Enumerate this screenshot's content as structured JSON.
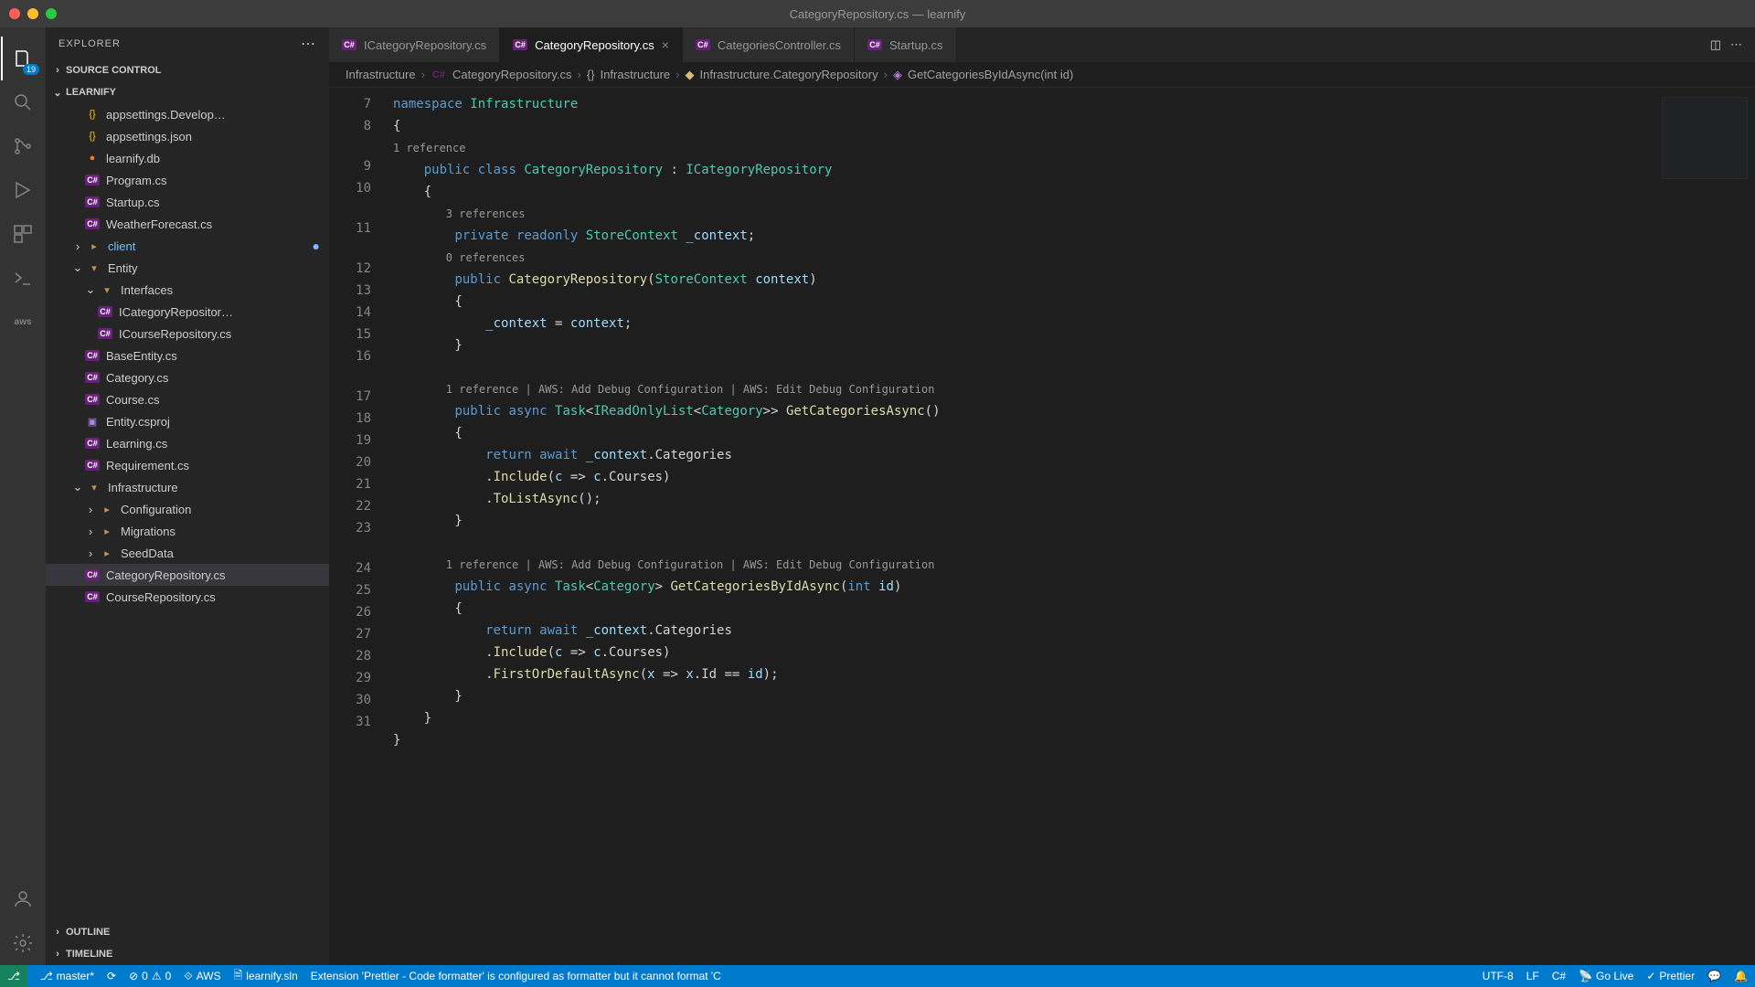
{
  "window": {
    "title": "CategoryRepository.cs — learnify"
  },
  "activitybar": {
    "badge": "19",
    "aws": "aws"
  },
  "explorer": {
    "title": "EXPLORER",
    "sections": {
      "source_control": "SOURCE CONTROL",
      "project": "LEARNIFY",
      "outline": "OUTLINE",
      "timeline": "TIMELINE"
    },
    "tree": {
      "appsettings_dev": "appsettings.Develop…",
      "appsettings": "appsettings.json",
      "learnifydb": "learnify.db",
      "program": "Program.cs",
      "startup": "Startup.cs",
      "weather": "WeatherForecast.cs",
      "client": "client",
      "entity": "Entity",
      "interfaces": "Interfaces",
      "icategory": "ICategoryRepositor…",
      "icourse": "ICourseRepository.cs",
      "baseentity": "BaseEntity.cs",
      "category": "Category.cs",
      "course": "Course.cs",
      "entitycsproj": "Entity.csproj",
      "learning": "Learning.cs",
      "requirement": "Requirement.cs",
      "infrastructure": "Infrastructure",
      "configuration": "Configuration",
      "migrations": "Migrations",
      "seeddata": "SeedData",
      "catrepo": "CategoryRepository.cs",
      "courserepo": "CourseRepository.cs"
    }
  },
  "tabs": {
    "t1": "ICategoryRepository.cs",
    "t2": "CategoryRepository.cs",
    "t3": "CategoriesController.cs",
    "t4": "Startup.cs"
  },
  "breadcrumb": {
    "b1": "Infrastructure",
    "b2": "CategoryRepository.cs",
    "b3": "Infrastructure",
    "b4": "Infrastructure.CategoryRepository",
    "b5": "GetCategoriesByIdAsync(int id)"
  },
  "code": {
    "lines": [
      "7",
      "8",
      "9",
      "10",
      "11",
      "12",
      "13",
      "14",
      "15",
      "16",
      "17",
      "18",
      "19",
      "20",
      "21",
      "22",
      "23",
      "24",
      "25",
      "26",
      "27",
      "28",
      "29",
      "30",
      "31"
    ],
    "codelens1": "1 reference",
    "codelens2": "3 references",
    "codelens3": "0 references",
    "codelens4": "1 reference | AWS: Add Debug Configuration | AWS: Edit Debug Configuration",
    "codelens5": "1 reference | AWS: Add Debug Configuration | AWS: Edit Debug Configuration"
  },
  "statusbar": {
    "branch": "master*",
    "errors": "0",
    "warnings": "0",
    "aws": "AWS",
    "sln": "learnify.sln",
    "message": "Extension 'Prettier - Code formatter' is configured as formatter but it cannot format 'C",
    "encoding": "UTF-8",
    "eol": "LF",
    "lang": "C#",
    "golive": "Go Live",
    "prettier": "Prettier"
  }
}
